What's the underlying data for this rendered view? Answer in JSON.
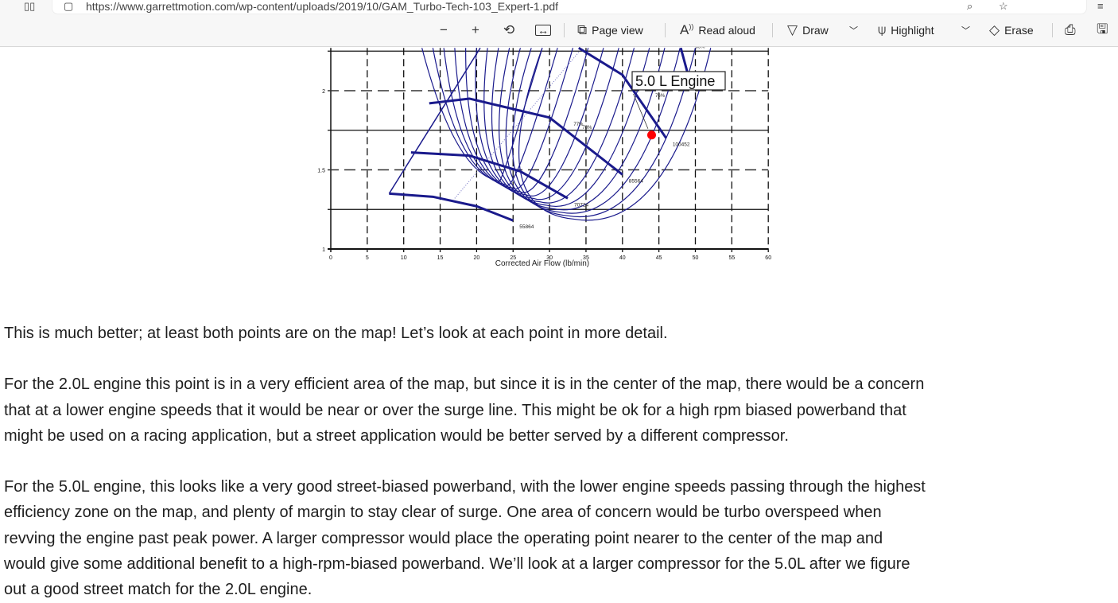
{
  "browser": {
    "url": "https://www.garrettmotion.com/wp-content/uploads/2019/10/GAM_Turbo-Tech-103_Expert-1.pdf"
  },
  "toolbar": {
    "zoom_out": "−",
    "zoom_in": "+",
    "page_view": "Page view",
    "read_aloud": "Read aloud",
    "draw": "Draw",
    "highlight": "Highlight",
    "erase": "Erase"
  },
  "chart_data": {
    "type": "line",
    "xlabel": "Corrected Air Flow (lb/min)",
    "xlim": [
      0,
      60
    ],
    "ylim": [
      1,
      2.27
    ],
    "x_ticks": [
      "0",
      "5",
      "10",
      "15",
      "20",
      "25",
      "30",
      "35",
      "40",
      "45",
      "50",
      "55",
      "60"
    ],
    "y_ticks": [
      "1",
      "1.5",
      "2"
    ],
    "speed_lines": [
      {
        "label": "55864",
        "points": [
          [
            8,
            1.35
          ],
          [
            14,
            1.33
          ],
          [
            20,
            1.27
          ],
          [
            25,
            1.18
          ]
        ]
      },
      {
        "label": "70724",
        "points": [
          [
            11,
            1.61
          ],
          [
            19,
            1.59
          ],
          [
            26,
            1.49
          ],
          [
            32.5,
            1.32
          ]
        ]
      },
      {
        "label": "85564",
        "points": [
          [
            13.5,
            1.92
          ],
          [
            19,
            1.95
          ],
          [
            30,
            1.83
          ],
          [
            40,
            1.47
          ]
        ]
      },
      {
        "label": "100452",
        "points": [
          [
            34,
            2.27
          ],
          [
            40,
            2.1
          ],
          [
            46,
            1.7
          ]
        ]
      },
      {
        "label": "115226",
        "points": [
          [
            48,
            2.27
          ],
          [
            49,
            2.1
          ]
        ]
      }
    ],
    "efficiency_labels": [
      "77%",
      "78%",
      "76%",
      "65%"
    ],
    "annotation": "5.0 L Engine",
    "operating_point": {
      "x": 44,
      "y": 1.72,
      "color": "#ff0000"
    },
    "line_color": "#1a1a8c"
  },
  "article": {
    "paragraphs": [
      [
        "This is much better; at least both points are on the map! Let’s look at each point in more detail."
      ],
      [
        "For the 2.0L engine this point is in a very efficient area of the map, but since it is in the center of the map, there would be a concern",
        "that at a lower engine speeds that it would be near or over the surge line. This might be ok for a high rpm biased powerband that",
        "might be used on a racing application, but a street application would be better served by a different compressor."
      ],
      [
        "For the 5.0L engine, this looks like a very good street-biased powerband, with the lower engine speeds passing through the highest",
        "efficiency zone on the map, and plenty of margin to stay clear of surge. One area of concern would be turbo overspeed when",
        "revving the engine past peak power. A larger compressor would place the operating point nearer to the center of the map and",
        "would give some additional benefit to a high-rpm-biased powerband. We’ll look at a larger compressor for the 5.0L after we figure",
        "out a good street match for the 2.0L engine."
      ]
    ]
  }
}
